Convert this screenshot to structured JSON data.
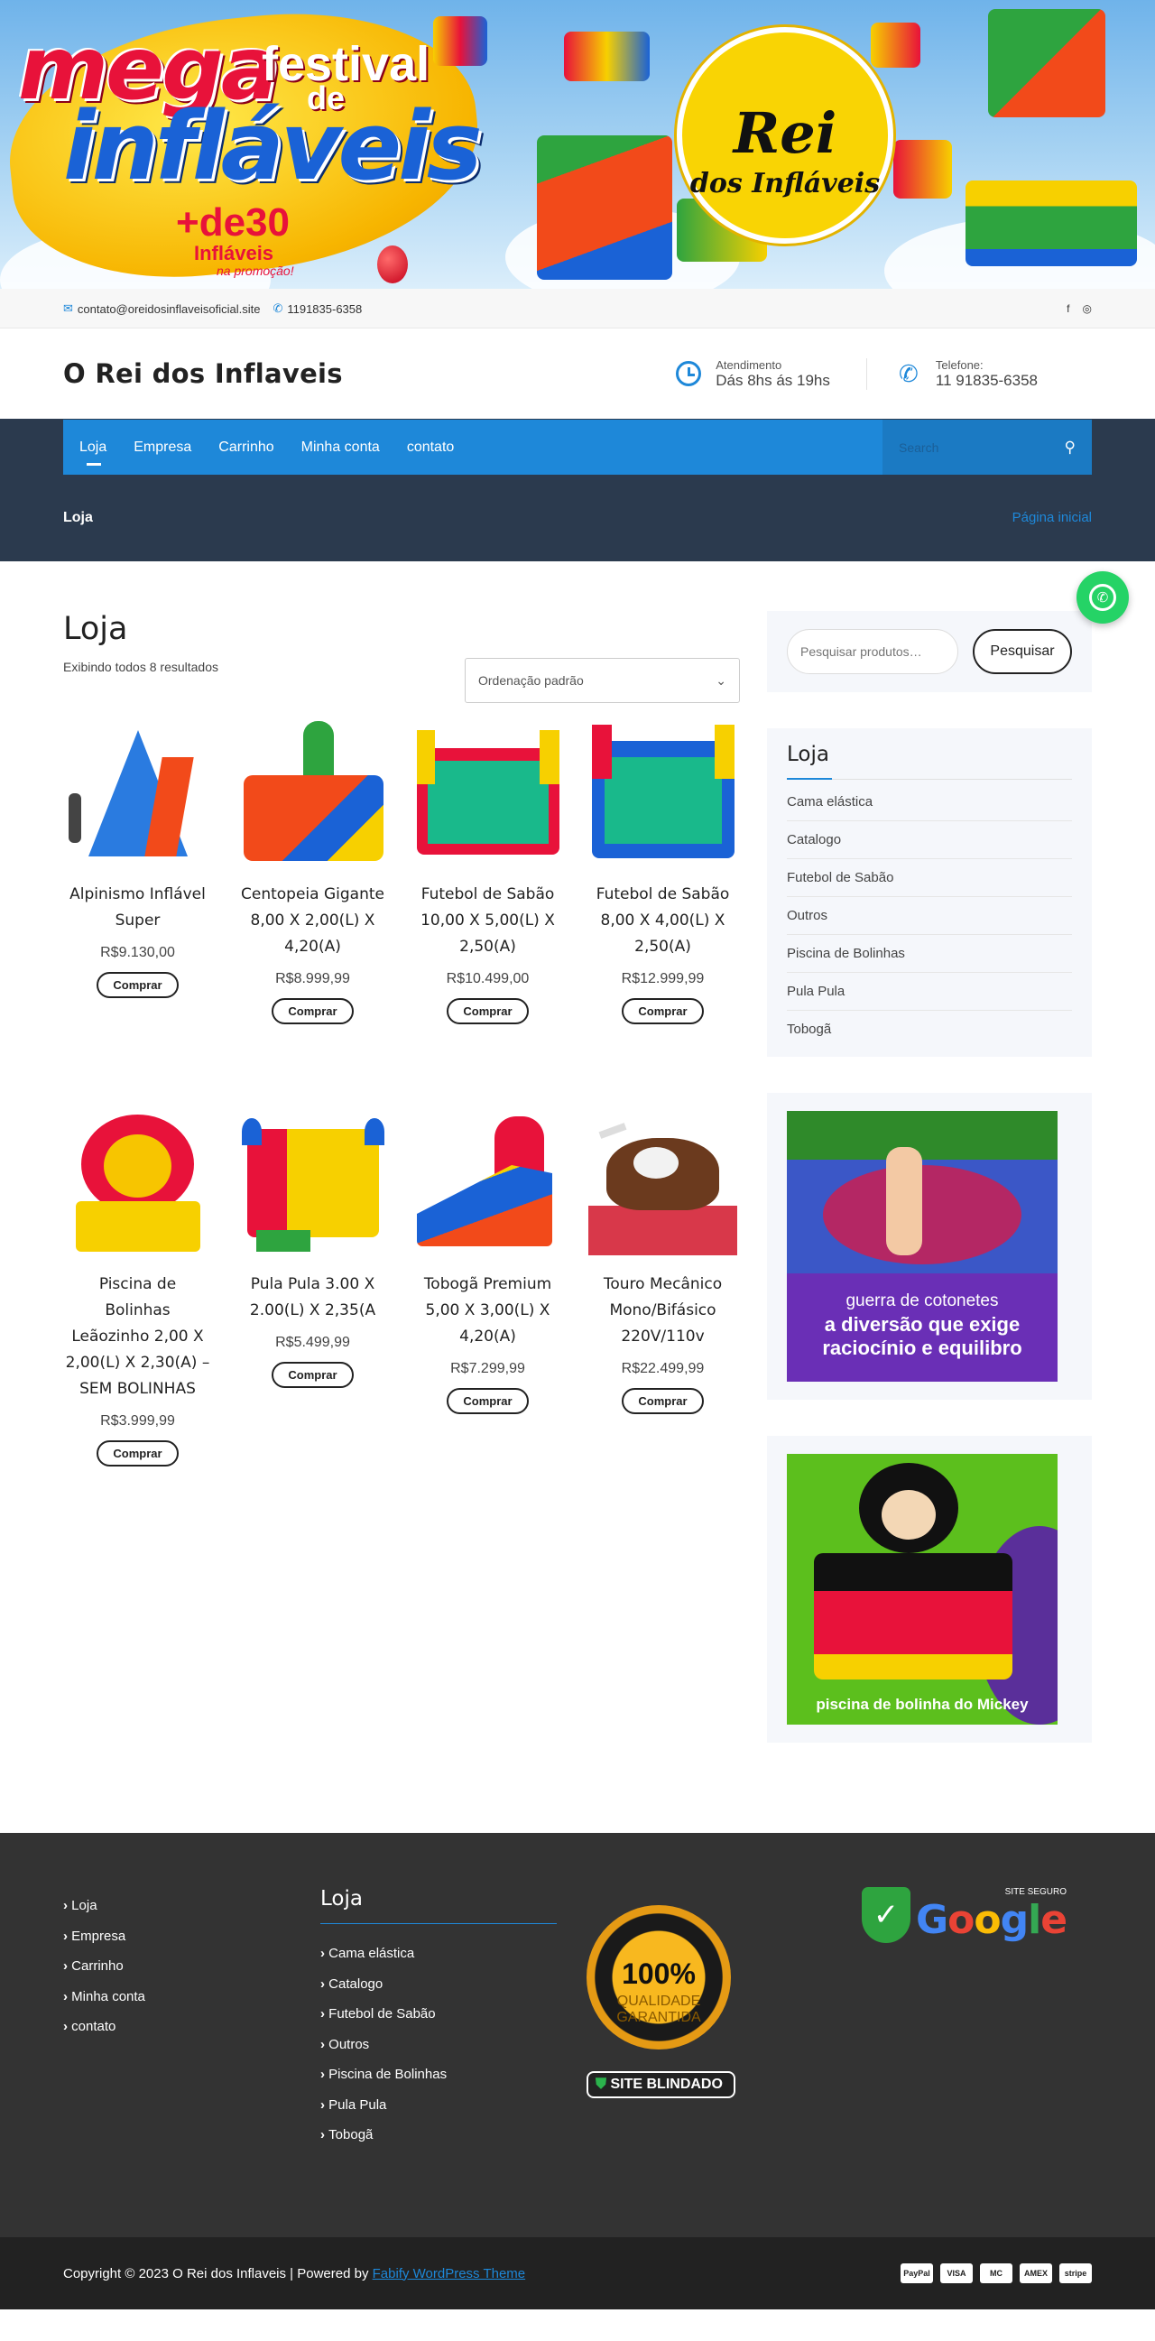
{
  "banner": {
    "mega": "mega",
    "festival": "festival",
    "de": "de",
    "inflaveis": "infláveis",
    "plus30": "+de30",
    "plus30_sub": "Infláveis",
    "plus30_sub2": "na promoção!",
    "rei_main": "Rei",
    "rei_sub": "dos Infláveis"
  },
  "topbar": {
    "email": "contato@oreidosinflaveisoficial.site",
    "phone": "1191835-6358",
    "social": [
      "facebook-icon",
      "instagram-icon"
    ]
  },
  "header": {
    "site_title": "O Rei dos Inflaveis",
    "hours_label": "Atendimento",
    "hours_value": "Dás 8hs ás 19hs",
    "phone_label": "Telefone:",
    "phone_value": "11 91835-6358"
  },
  "nav": {
    "items": [
      "Loja",
      "Empresa",
      "Carrinho",
      "Minha conta",
      "contato"
    ],
    "search_placeholder": "Search"
  },
  "titleband": {
    "title": "Loja",
    "crumb": "Página inicial"
  },
  "shop": {
    "title": "Loja",
    "result_count": "Exibindo todos 8 resultados",
    "ordering": "Ordenação padrão",
    "buy_label": "Comprar",
    "products": [
      {
        "name": "Alpinismo Inflável Super",
        "price": "R$9.130,00"
      },
      {
        "name": "Centopeia Gigante 8,00 X 2,00(L) X 4,20(A)",
        "price": "R$8.999,99"
      },
      {
        "name": "Futebol de Sabão 10,00 X 5,00(L) X 2,50(A)",
        "price": "R$10.499,00"
      },
      {
        "name": "Futebol de Sabão 8,00 X 4,00(L) X 2,50(A)",
        "price": "R$12.999,99"
      },
      {
        "name": "Piscina de Bolinhas Leãozinho 2,00 X 2,00(L) X 2,30(A) – SEM BOLINHAS",
        "price": "R$3.999,99"
      },
      {
        "name": "Pula Pula 3.00 X 2.00(L) X 2,35(A",
        "price": "R$5.499,99"
      },
      {
        "name": "Tobogã Premium 5,00 X 3,00(L) X 4,20(A)",
        "price": "R$7.299,99"
      },
      {
        "name": "Touro Mecânico Mono/Bifásico 220V/110v",
        "price": "R$22.499,99"
      }
    ]
  },
  "sidebar": {
    "search_placeholder": "Pesquisar produtos…",
    "search_button": "Pesquisar",
    "categories_title": "Loja",
    "categories": [
      "Cama elástica",
      "Catalogo",
      "Futebol de Sabão",
      "Outros",
      "Piscina de Bolinhas",
      "Pula Pula",
      "Tobogã"
    ],
    "promo1_line1": "guerra de cotonetes",
    "promo1_line2": "a diversão que exige",
    "promo1_line3": "raciocínio e equilibro",
    "promo2_text": "piscina de bolinha do Mickey"
  },
  "footer": {
    "menu": [
      "Loja",
      "Empresa",
      "Carrinho",
      "Minha conta",
      "contato"
    ],
    "cat_title": "Loja",
    "categories": [
      "Cama elástica",
      "Catalogo",
      "Futebol de Sabão",
      "Outros",
      "Piscina de Bolinhas",
      "Pula Pula",
      "Tobogã"
    ],
    "seal_value": "100%",
    "seal_text": "QUALIDADE GARANTIDA",
    "blindado_a": "SITE",
    "blindado_b": "BLINDADO",
    "google_small": "SITE SEGURO",
    "google": "Google",
    "copyright": "Copyright © 2023 O Rei dos Inflaveis | Powered by",
    "powered_link": "Fabify WordPress Theme",
    "payments": [
      "PayPal",
      "VISA",
      "MC",
      "AMEX",
      "stripe"
    ]
  },
  "colors": {
    "accent": "#1e88d9",
    "dark_band": "#2b3a4e",
    "footer": "#333333",
    "whatsapp": "#25d366"
  }
}
